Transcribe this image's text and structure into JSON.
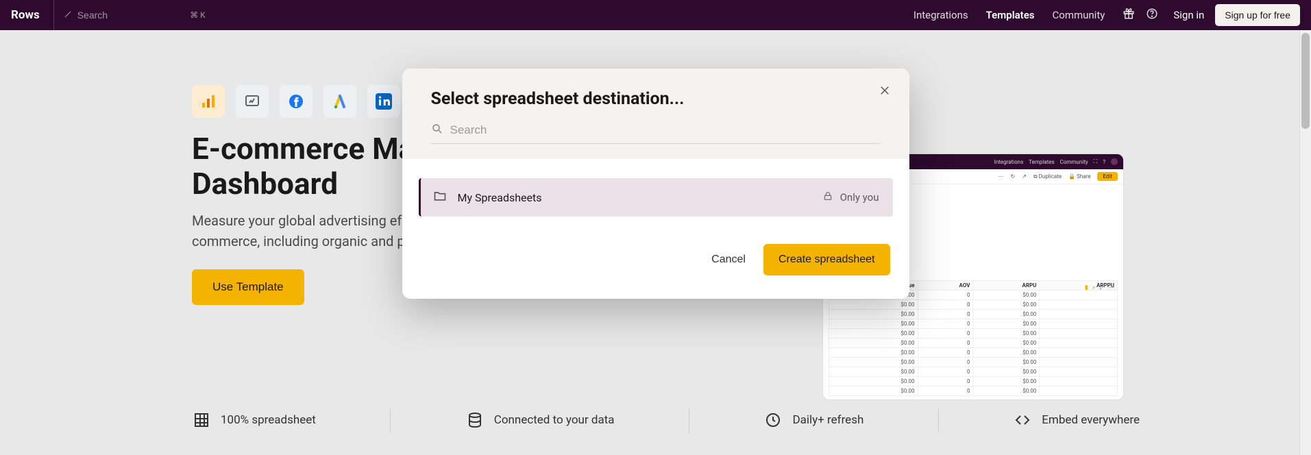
{
  "nav": {
    "brand": "Rows",
    "search_placeholder": "Search",
    "search_shortcut": "⌘ K",
    "links": {
      "integrations": "Integrations",
      "templates": "Templates",
      "community": "Community"
    },
    "signin": "Sign in",
    "signup": "Sign up for free"
  },
  "hero": {
    "title_line1": "E-commerce Ma",
    "title_line2": "Dashboard",
    "desc_line1": "Measure your global advertising effo",
    "desc_line2": "commerce, including organic and pa",
    "cta": "Use Template"
  },
  "preview": {
    "nav": {
      "integrations": "Integrations",
      "templates": "Templates",
      "community": "Community"
    },
    "bar": {
      "duplicate": "Duplicate",
      "share": "Share",
      "edit": "Edit"
    },
    "headers": [
      "Revenue",
      "AOV",
      "ARPU",
      "ARPPU"
    ],
    "rows": [
      [
        "$0.00",
        "0",
        "$0.00",
        ""
      ],
      [
        "$0.00",
        "0",
        "$0.00",
        ""
      ],
      [
        "$0.00",
        "0",
        "$0.00",
        ""
      ],
      [
        "$0.00",
        "0",
        "$0.00",
        ""
      ],
      [
        "$0.00",
        "0",
        "$0.00",
        ""
      ],
      [
        "$0.00",
        "0",
        "$0.00",
        ""
      ],
      [
        "$0.00",
        "0",
        "$0.00",
        ""
      ],
      [
        "$0.00",
        "0",
        "$0.00",
        ""
      ],
      [
        "$0.00",
        "0",
        "$0.00",
        ""
      ],
      [
        "$0.00",
        "0",
        "$0.00",
        ""
      ],
      [
        "$0.00",
        "0",
        "$0.00",
        ""
      ]
    ]
  },
  "features": {
    "spreadsheet": "100% spreadsheet",
    "connected": "Connected to your data",
    "refresh": "Daily+ refresh",
    "embed": "Embed everywhere"
  },
  "modal": {
    "title": "Select spreadsheet destination...",
    "search_placeholder": "Search",
    "folder_label": "My Spreadsheets",
    "privacy_label": "Only you",
    "cancel": "Cancel",
    "create": "Create spreadsheet"
  }
}
